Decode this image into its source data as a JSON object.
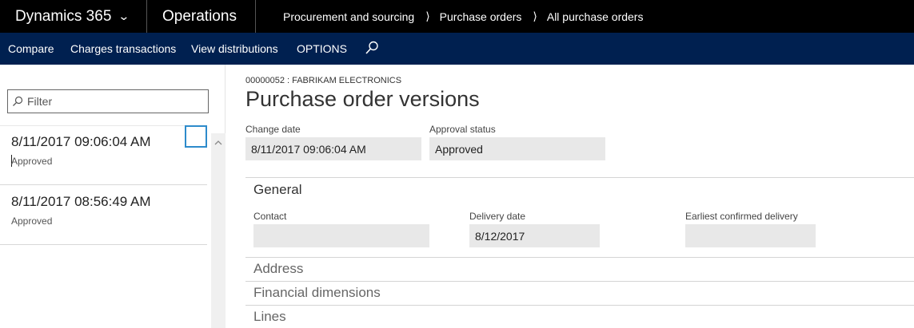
{
  "nav": {
    "app_name": "Dynamics 365",
    "module": "Operations",
    "breadcrumbs": [
      "Procurement and sourcing",
      "Purchase orders",
      "All purchase orders"
    ]
  },
  "actions": {
    "compare": "Compare",
    "charges": "Charges transactions",
    "distributions": "View distributions",
    "options": "OPTIONS"
  },
  "list": {
    "filter_placeholder": "Filter",
    "items": [
      {
        "datetime": "8/11/2017 09:06:04 AM",
        "status": "Approved"
      },
      {
        "datetime": "8/11/2017 08:56:49 AM",
        "status": "Approved"
      }
    ]
  },
  "details": {
    "record_id": "00000052 : FABRIKAM ELECTRONICS",
    "title": "Purchase order versions",
    "change_date_label": "Change date",
    "change_date": "8/11/2017 09:06:04 AM",
    "approval_label": "Approval status",
    "approval": "Approved",
    "general": {
      "title": "General",
      "contact_label": "Contact",
      "contact": "",
      "delivery_label": "Delivery date",
      "delivery": "8/12/2017",
      "earliest_label": "Earliest confirmed delivery",
      "earliest": ""
    },
    "address": "Address",
    "financial": "Financial dimensions",
    "lines": "Lines"
  },
  "colors": {
    "nav_bg": "#000000",
    "action_bg": "#002050",
    "accent": "#2d8bcb",
    "field_bg": "#e8e8e8"
  },
  "icons": [
    "chevron-down-icon",
    "chevron-right-icon",
    "search-icon",
    "scroll-up-icon"
  ]
}
